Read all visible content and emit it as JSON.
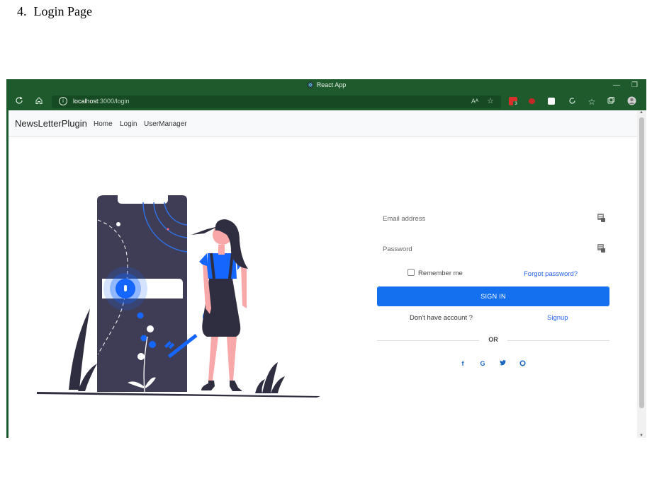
{
  "document": {
    "number": "4.",
    "heading": "Login Page"
  },
  "browser": {
    "tab_title": "React App",
    "url_host": "localhost",
    "url_path": ":3000/login",
    "read_aloud": "Aᴬ",
    "minimize": "—",
    "restore": "❐",
    "ext_badge": "3",
    "colors": {
      "frame": "#1e5a2b",
      "address_bar": "#164a22"
    }
  },
  "navbar": {
    "brand": "NewsLetterPlugin",
    "links": [
      "Home",
      "Login",
      "UserManager"
    ]
  },
  "login": {
    "email_placeholder": "Email address",
    "password_placeholder": "Password",
    "remember_label": "Remember me",
    "forgot_label": "Forgot password?",
    "signin_label": "SIGN IN",
    "no_account_text": "Don't have account ?",
    "signup_label": "Signup",
    "or_text": "OR",
    "social_icons": [
      "facebook-icon",
      "google-icon",
      "twitter-icon",
      "github-icon"
    ],
    "social_glyphs": [
      "f",
      "G",
      "•",
      "○"
    ],
    "colors": {
      "primary": "#1570ef",
      "link": "#2563eb"
    }
  }
}
